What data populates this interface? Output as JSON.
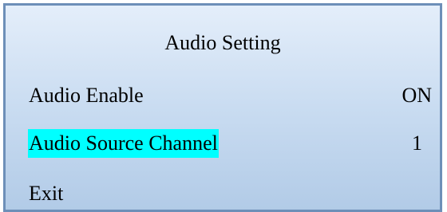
{
  "menu": {
    "title": "Audio Setting",
    "items": [
      {
        "label": "Audio Enable",
        "value": "ON",
        "selected": false
      },
      {
        "label": "Audio Source Channel",
        "value": "1",
        "selected": true
      },
      {
        "label": "Exit",
        "selected": false
      }
    ]
  },
  "colors": {
    "selection_highlight": "#00ffff",
    "panel_border": "#6d8fb8",
    "panel_gradient_top": "#e4eefa",
    "panel_gradient_bottom": "#b2cbe7"
  }
}
